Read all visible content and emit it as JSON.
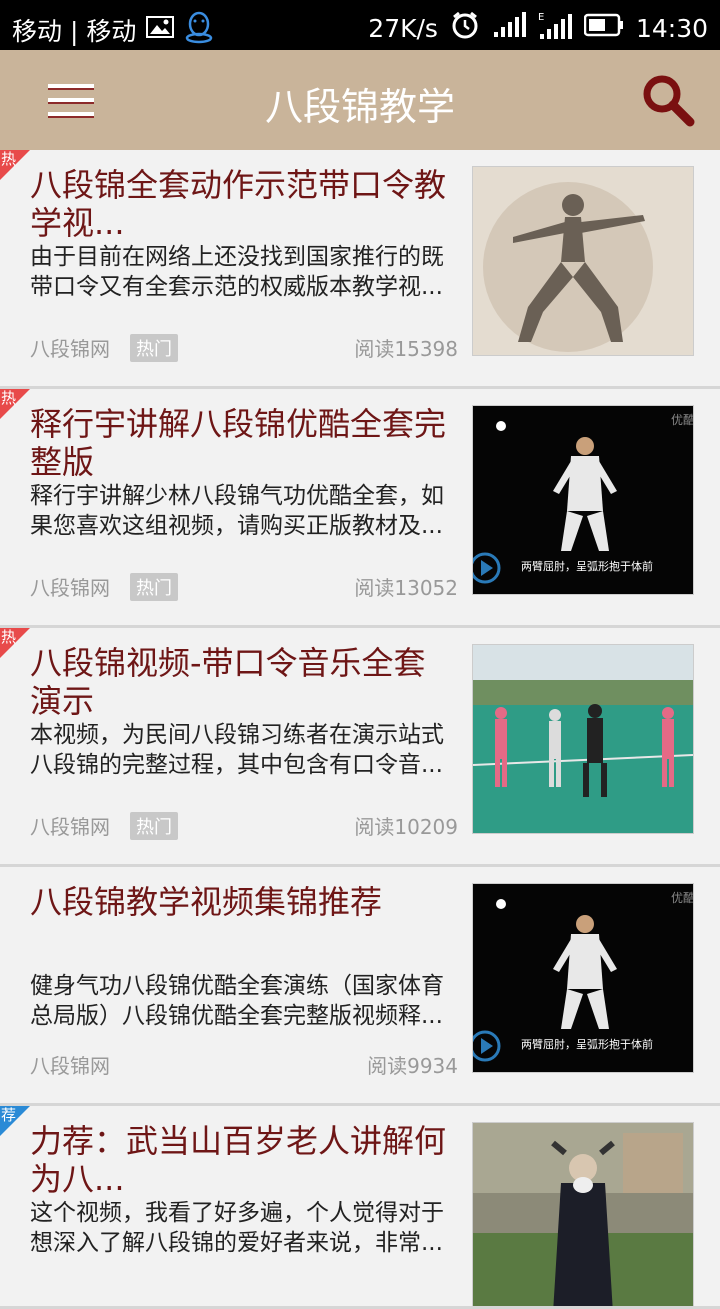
{
  "status_bar": {
    "carriers": "移动 | 移动",
    "speed": "27K/s",
    "time": "14:30"
  },
  "app_bar": {
    "title": "八段锦教学"
  },
  "items": [
    {
      "badge": "热",
      "title": "八段锦全套动作示范带口令教学视...",
      "desc": "由于目前在网络上还没找到国家推行的既带口令又有全套示范的权威版本教学视...",
      "source": "八段锦网",
      "tag": "热门",
      "reads": "阅读15398"
    },
    {
      "badge": "热",
      "title": "释行宇讲解八段锦优酷全套完整版",
      "desc": "释行宇讲解少林八段锦气功优酷全套，如果您喜欢这组视频，请购买正版教材及...",
      "source": "八段锦网",
      "tag": "热门",
      "reads": "阅读13052",
      "thumb_caption": "两臂屈肘，呈弧形抱于体前",
      "thumb_watermark": "优酷"
    },
    {
      "badge": "热",
      "title": "八段锦视频-带口令音乐全套演示",
      "desc": "本视频，为民间八段锦习练者在演示站式八段锦的完整过程，其中包含有口令音...",
      "source": "八段锦网",
      "tag": "热门",
      "reads": "阅读10209"
    },
    {
      "title": "八段锦教学视频集锦推荐",
      "desc": "健身气功八段锦优酷全套演练（国家体育总局版）八段锦优酷全套完整版视频释...",
      "source": "八段锦网",
      "reads": "阅读9934",
      "thumb_caption": "两臂屈肘，呈弧形抱于体前",
      "thumb_watermark": "优酷"
    },
    {
      "badge": "荐",
      "title": "力荐：武当山百岁老人讲解何为八...",
      "desc": "这个视频，我看了好多遍，个人觉得对于想深入了解八段锦的爱好者来说，非常..."
    }
  ]
}
